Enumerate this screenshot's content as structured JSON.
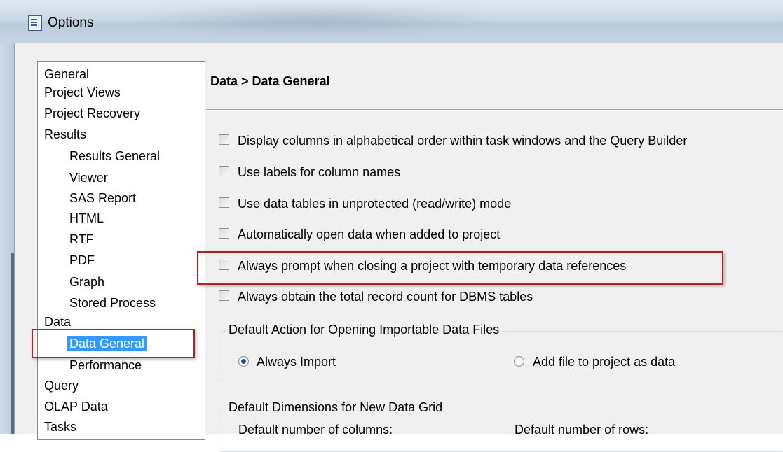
{
  "window": {
    "title": "Options",
    "icon": "options-window-icon"
  },
  "nav": {
    "items": [
      {
        "label": "General",
        "level": 0
      },
      {
        "label": "Project Views",
        "level": 0
      },
      {
        "label": "Project Recovery",
        "level": 0
      },
      {
        "label": "Results",
        "level": 0
      },
      {
        "label": "Results General",
        "level": 1
      },
      {
        "label": "Viewer",
        "level": 1
      },
      {
        "label": "SAS Report",
        "level": 1
      },
      {
        "label": "HTML",
        "level": 1
      },
      {
        "label": "RTF",
        "level": 1
      },
      {
        "label": "PDF",
        "level": 1
      },
      {
        "label": "Graph",
        "level": 1
      },
      {
        "label": "Stored Process",
        "level": 1
      },
      {
        "label": "Data",
        "level": 0
      },
      {
        "label": "Data General",
        "level": 1,
        "selected": true
      },
      {
        "label": "Performance",
        "level": 1
      },
      {
        "label": "Query",
        "level": 0
      },
      {
        "label": "OLAP Data",
        "level": 0
      },
      {
        "label": "Tasks",
        "level": 0
      }
    ]
  },
  "content": {
    "title": "Data > Data General",
    "options": [
      {
        "label": "Display columns in alphabetical order within task windows and the Query Builder",
        "checked": false
      },
      {
        "label": "Use labels for column names",
        "checked": false
      },
      {
        "label": "Use data tables in unprotected (read/write) mode",
        "checked": false
      },
      {
        "label": "Automatically open data when added to project",
        "checked": false
      },
      {
        "label": "Always prompt when closing a project with temporary data references",
        "checked": false
      },
      {
        "label": "Always obtain the total record count for DBMS tables",
        "checked": false
      }
    ],
    "import_group": {
      "title": "Default Action for Opening Importable Data Files",
      "options": [
        {
          "label": "Always Import",
          "selected": true
        },
        {
          "label": "Add file to project as data",
          "selected": false
        }
      ]
    },
    "grid_group": {
      "title": "Default Dimensions for New Data Grid",
      "columns_label": "Default number of columns:",
      "rows_label": "Default number of rows:"
    }
  },
  "colors": {
    "highlight": "#b22222",
    "selection": "#3399ff"
  }
}
